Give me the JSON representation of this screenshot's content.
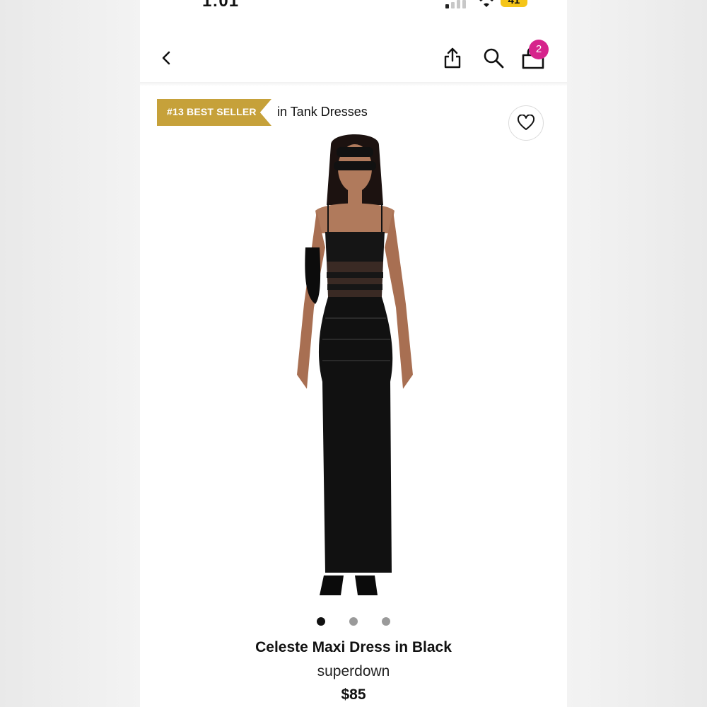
{
  "status_bar": {
    "time": "1:01",
    "battery": "41"
  },
  "header": {
    "back_icon": "chevron-left-icon",
    "share_icon": "share-icon",
    "search_icon": "search-icon",
    "bag_icon": "shopping-bag-icon",
    "bag_count": "2",
    "badge_color": "#d6248c"
  },
  "bestseller": {
    "badge": "#13 BEST SELLER",
    "category": "in Tank Dresses",
    "badge_color": "#c6a13a"
  },
  "favorite_icon": "heart-icon",
  "carousel": {
    "total": 3,
    "active": 1
  },
  "product": {
    "name": "Celeste Maxi Dress in Black",
    "brand": "superdown",
    "price": "$85"
  }
}
